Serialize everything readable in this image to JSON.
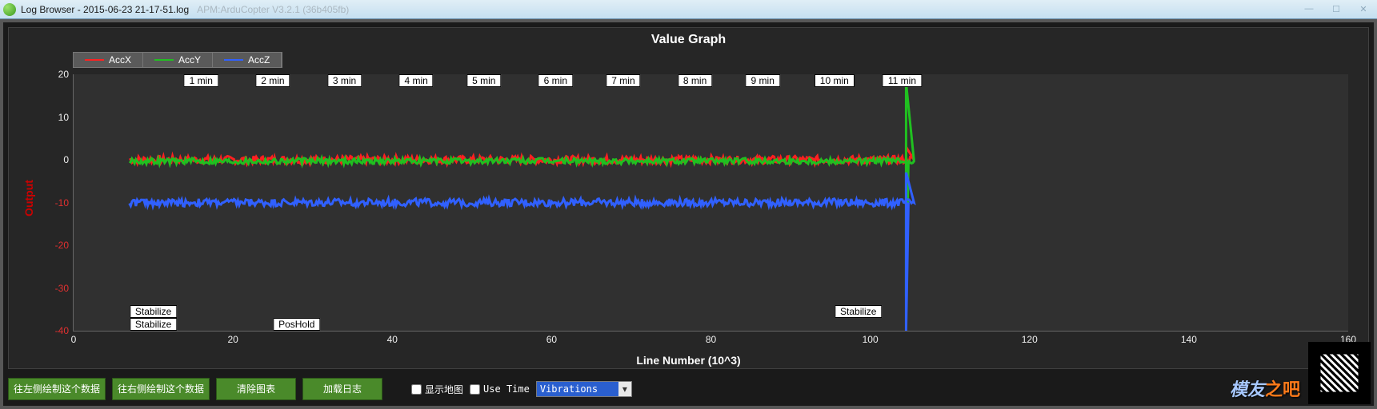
{
  "window": {
    "title_main": "Log Browser - 2015-06-23 21-17-51.log",
    "title_faded": "APM:ArduCopter V3.2.1 (36b405fb)",
    "btn_min": "—",
    "btn_max": "☐",
    "btn_close": "✕"
  },
  "chart_data": {
    "type": "line",
    "title": "Value Graph",
    "xlabel": "Line Number (10^3)",
    "ylabel": "Output",
    "ylim": [
      -40,
      20
    ],
    "xlim": [
      0,
      160
    ],
    "xticks": [
      0,
      20,
      40,
      60,
      80,
      100,
      120,
      140,
      160
    ],
    "yticks": [
      -40,
      -30,
      -20,
      -10,
      0,
      10,
      20
    ],
    "time_markers": [
      {
        "x": 16,
        "label": "1 min"
      },
      {
        "x": 25,
        "label": "2 min"
      },
      {
        "x": 34,
        "label": "3 min"
      },
      {
        "x": 43,
        "label": "4 min"
      },
      {
        "x": 51.5,
        "label": "5 min"
      },
      {
        "x": 60.5,
        "label": "6 min"
      },
      {
        "x": 69,
        "label": "7 min"
      },
      {
        "x": 78,
        "label": "8 min"
      },
      {
        "x": 86.5,
        "label": "9 min"
      },
      {
        "x": 95.5,
        "label": "10 min"
      },
      {
        "x": 104,
        "label": "11 min"
      }
    ],
    "mode_markers": [
      {
        "x": 10,
        "y_offset": 0,
        "label": "Stabilize"
      },
      {
        "x": 10,
        "y_offset": 1,
        "label": "Stabilize"
      },
      {
        "x": 28,
        "y_offset": 0,
        "label": "PosHold"
      },
      {
        "x": 98.5,
        "y_offset": 1,
        "label": "Stabilize"
      }
    ],
    "series": [
      {
        "name": "AccX",
        "color": "#ff2020",
        "baseline": 0,
        "noise": 0.9,
        "spike_x": 104.5,
        "spike_lo": -2,
        "spike_hi": 3
      },
      {
        "name": "AccY",
        "color": "#20c020",
        "baseline": -0.3,
        "noise": 0.7,
        "spike_x": 104.5,
        "spike_lo": -32,
        "spike_hi": 18
      },
      {
        "name": "AccZ",
        "color": "#3060ff",
        "baseline": -10,
        "noise": 0.9,
        "spike_x": 104.5,
        "spike_lo": -40,
        "spike_hi": -3
      }
    ]
  },
  "toolbar": {
    "btn_left": "往左侧绘制这个数据",
    "btn_right": "往右侧绘制这个数据",
    "btn_clear": "清除图表",
    "btn_load": "加载日志",
    "chk_map": "显示地图",
    "chk_time": "Use Time",
    "combo_value": "Vibrations"
  },
  "brand": {
    "text": "模友",
    "accent": "之吧"
  }
}
